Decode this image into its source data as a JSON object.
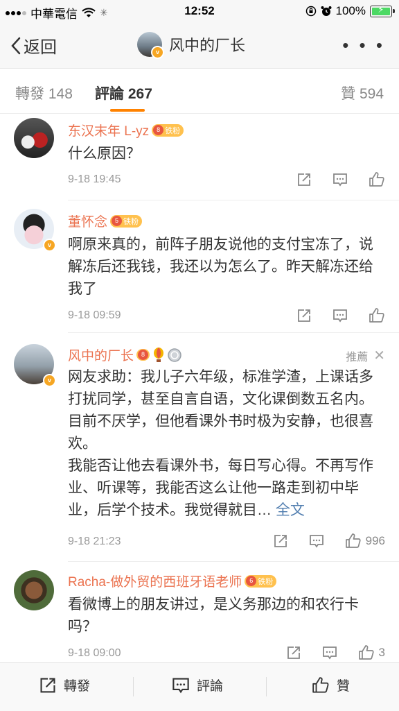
{
  "status_bar": {
    "carrier": "中華電信",
    "time": "12:52",
    "battery": "100%"
  },
  "nav": {
    "back_label": "返回",
    "title": "风中的厂长",
    "more_label": "• • •"
  },
  "tabs": {
    "repost": "轉發 148",
    "comment": "評論 267",
    "like": "贊 594"
  },
  "comments": [
    {
      "name": "东汉末年 L-yz",
      "badge": "铁粉",
      "badge_level": "8",
      "text": "什么原因？",
      "time": "9-18 19:45"
    },
    {
      "name": "董怀念",
      "badge": "铁粉",
      "badge_level": "5",
      "text": "啊原来真的，前阵子朋友说他的支付宝冻了，说解冻后还我钱，我还以为怎么了。昨天解冻还给我了",
      "time": "9-18 09:59"
    },
    {
      "name": "风中的厂长",
      "badge_level": "8",
      "pinned_label": "推薦",
      "text_lines": [
        "网友求助：我儿子六年级，标准学渣，上课话多打扰同学，甚至自言自语，文化课倒数五名内。目前不厌学，但他看课外书时极为安静，也很喜欢。",
        "我能否让他去看课外书，每日写心得。不再写作业、听课等，我能否这么让他一路走到初中毕业，后学个技术。我觉得就目… "
      ],
      "full_text_label": "全文",
      "time": "9-18 21:23",
      "likes": "996"
    },
    {
      "name": "Racha-做外贸的西班牙语老师",
      "badge": "铁粉",
      "badge_level": "6",
      "text": "看微博上的朋友讲过，是义务那边的和农行卡吗？",
      "time": "9-18 09:00",
      "likes": "3"
    }
  ],
  "bottom_bar": {
    "repost": "轉發",
    "comment": "評論",
    "like": "贊"
  },
  "colors": {
    "accent": "#ff8200",
    "username": "#eb7350",
    "link": "#507daf",
    "fan_badge": "#ffc14e"
  }
}
